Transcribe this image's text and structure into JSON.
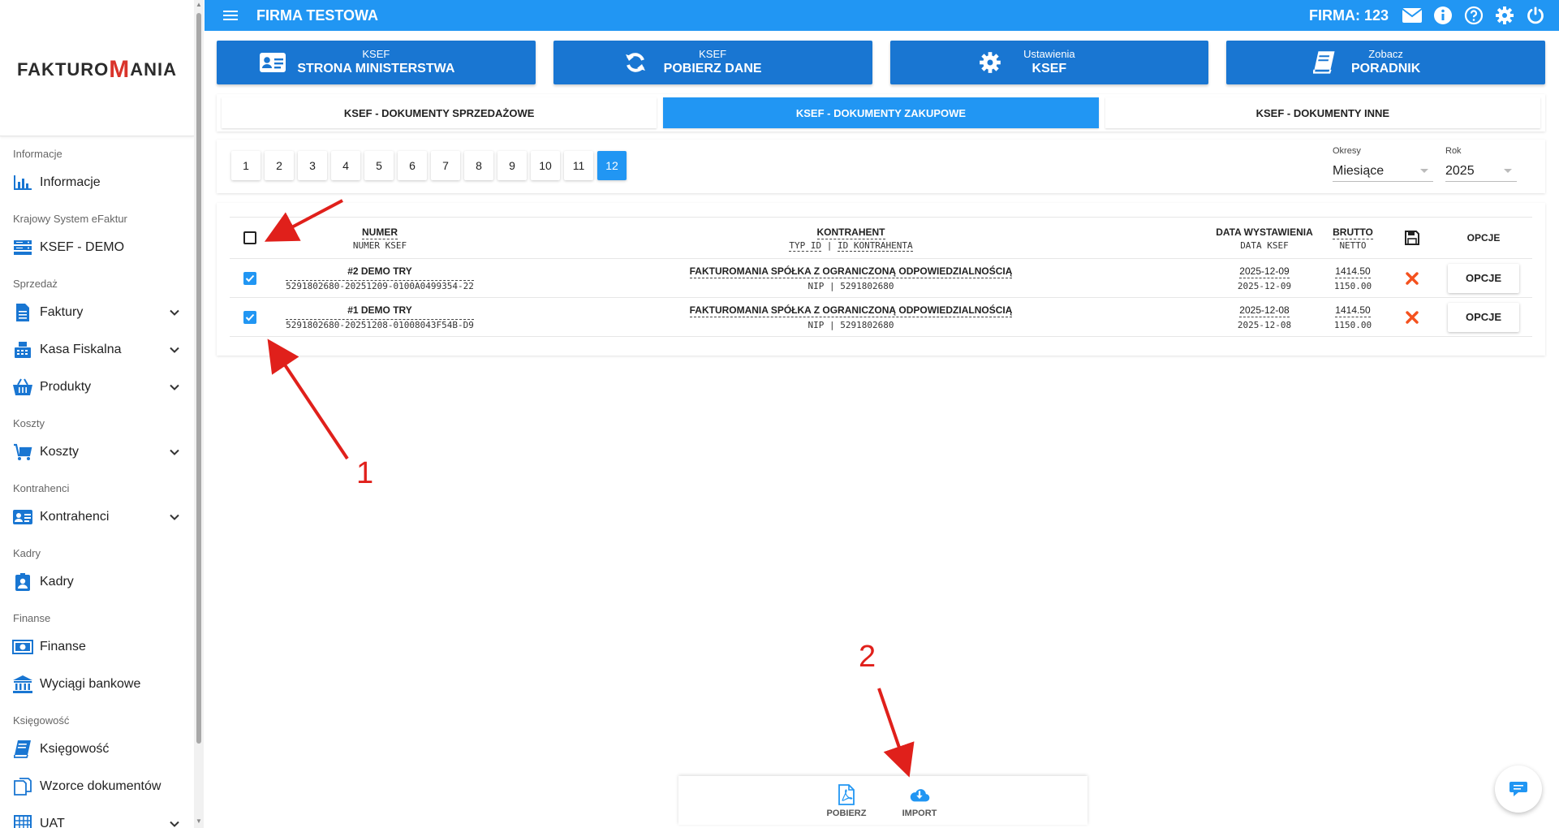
{
  "logo": {
    "part1": "FAKTURO",
    "part2": "M",
    "part3": "ANIA"
  },
  "sidebar": {
    "sections": [
      {
        "title": "Informacje",
        "items": [
          {
            "label": "Informacje",
            "icon": "chart-icon",
            "expandable": false
          }
        ]
      },
      {
        "title": "Krajowy System eFaktur",
        "items": [
          {
            "label": "KSEF - DEMO",
            "icon": "server-icon",
            "expandable": false
          }
        ]
      },
      {
        "title": "Sprzedaż",
        "items": [
          {
            "label": "Faktury",
            "icon": "document-icon",
            "expandable": true
          },
          {
            "label": "Kasa Fiskalna",
            "icon": "cash-register-icon",
            "expandable": true
          },
          {
            "label": "Produkty",
            "icon": "basket-icon",
            "expandable": true
          }
        ]
      },
      {
        "title": "Koszty",
        "items": [
          {
            "label": "Koszty",
            "icon": "cart-icon",
            "expandable": true
          }
        ]
      },
      {
        "title": "Kontrahenci",
        "items": [
          {
            "label": "Kontrahenci",
            "icon": "id-card-icon",
            "expandable": true
          }
        ]
      },
      {
        "title": "Kadry",
        "items": [
          {
            "label": "Kadry",
            "icon": "user-badge-icon",
            "expandable": false
          }
        ]
      },
      {
        "title": "Finanse",
        "items": [
          {
            "label": "Finanse",
            "icon": "money-icon",
            "expandable": false
          },
          {
            "label": "Wyciągi bankowe",
            "icon": "bank-icon",
            "expandable": false
          }
        ]
      },
      {
        "title": "Księgowość",
        "items": [
          {
            "label": "Księgowość",
            "icon": "book-icon",
            "expandable": false
          },
          {
            "label": "Wzorce dokumentów",
            "icon": "copy-icon",
            "expandable": false
          },
          {
            "label": "UAT",
            "icon": "grid-icon",
            "expandable": true
          }
        ]
      }
    ]
  },
  "topbar": {
    "company": "FIRMA TESTOWA",
    "firma": "FIRMA: 123"
  },
  "bigButtons": [
    {
      "sub": "KSEF",
      "main": "STRONA MINISTERSTWA",
      "icon": "id-card-icon"
    },
    {
      "sub": "KSEF",
      "main": "POBIERZ DANE",
      "icon": "refresh-icon"
    },
    {
      "sub": "Ustawienia",
      "main": "KSEF",
      "icon": "gear-icon"
    },
    {
      "sub": "Zobacz",
      "main": "PORADNIK",
      "icon": "book-icon"
    }
  ],
  "tabs": [
    {
      "label": "KSEF - DOKUMENTY SPRZEDAŻOWE",
      "active": false
    },
    {
      "label": "KSEF - DOKUMENTY ZAKUPOWE",
      "active": true
    },
    {
      "label": "KSEF - DOKUMENTY INNE",
      "active": false
    }
  ],
  "pagination": {
    "pages": [
      "1",
      "2",
      "3",
      "4",
      "5",
      "6",
      "7",
      "8",
      "9",
      "10",
      "11",
      "12"
    ],
    "active": "12"
  },
  "filters": {
    "okresy": {
      "label": "Okresy",
      "value": "Miesiące"
    },
    "rok": {
      "label": "Rok",
      "value": "2025"
    }
  },
  "table": {
    "headers": {
      "numer": "NUMER",
      "numer_ksef": "NUMER KSEF",
      "kontrahent": "KONTRAHENT",
      "typ_id": "TYP ID",
      "sep": "|",
      "id_kontrahenta": "ID KONTRAHENTA",
      "data_wystawienia": "DATA WYSTAWIENIA",
      "data_ksef": "DATA KSEF",
      "brutto": "BRUTTO",
      "netto": "NETTO",
      "opcje": "OPCJE"
    },
    "rows": [
      {
        "checked": true,
        "numer": "#2 DEMO TRY",
        "numer_ksef": "5291802680-20251209-0100A0499354-22",
        "kontrahent": "FAKTUROMANIA SPÓŁKA Z OGRANICZONĄ ODPOWIEDZIALNOŚCIĄ",
        "typ_id": "NIP",
        "sep": "|",
        "id": "5291802680",
        "data_wystawienia": "2025-12-09",
        "data_ksef": "2025-12-09",
        "brutto": "1414.50",
        "netto": "1150.00",
        "opcje": "OPCJE"
      },
      {
        "checked": true,
        "numer": "#1 DEMO TRY",
        "numer_ksef": "5291802680-20251208-01008043F54B-D9",
        "kontrahent": "FAKTUROMANIA SPÓŁKA Z OGRANICZONĄ ODPOWIEDZIALNOŚCIĄ",
        "typ_id": "NIP",
        "sep": "|",
        "id": "5291802680",
        "data_wystawienia": "2025-12-08",
        "data_ksef": "2025-12-08",
        "brutto": "1414.50",
        "netto": "1150.00",
        "opcje": "OPCJE"
      }
    ]
  },
  "bottomBar": [
    {
      "label": "POBIERZ",
      "icon": "pdf-icon"
    },
    {
      "label": "IMPORT",
      "icon": "cloud-download-icon"
    }
  ],
  "annotations": {
    "one": "1",
    "two": "2"
  },
  "colors": {
    "primary": "#2196f3",
    "buttonDark": "#1976d2",
    "delete": "#f4511e",
    "annotation": "#e0201b"
  }
}
